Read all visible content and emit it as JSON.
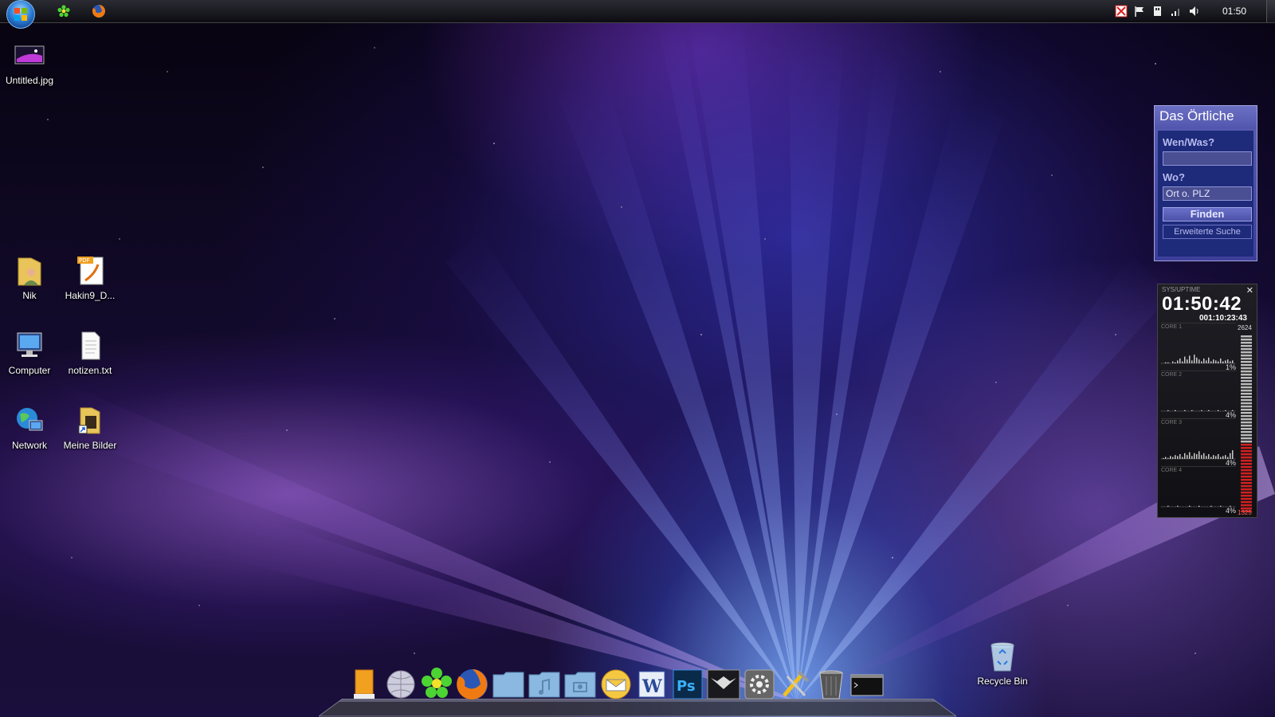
{
  "taskbar": {
    "clock": "01:50",
    "quick_launch": [
      "icq-icon",
      "firefox-icon"
    ],
    "tray_icons": [
      "security-alert-icon",
      "action-center-flag-icon",
      "usb-device-icon",
      "network-signal-icon",
      "volume-icon"
    ]
  },
  "desktop_icons": [
    {
      "name": "Untitled.jpg",
      "icon": "image-file-icon"
    },
    {
      "name": "Nik",
      "icon": "user-folder-icon"
    },
    {
      "name": "Hakin9_D...",
      "icon": "pdf-file-icon"
    },
    {
      "name": "Computer",
      "icon": "computer-icon"
    },
    {
      "name": "notizen.txt",
      "icon": "text-file-icon"
    },
    {
      "name": "Network",
      "icon": "network-icon"
    },
    {
      "name": "Meine Bilder",
      "icon": "pictures-shortcut-icon"
    }
  ],
  "recycle_bin": {
    "label": "Recycle Bin"
  },
  "gadget_oertliche": {
    "title": "Das Örtliche",
    "who_label": "Wen/Was?",
    "who_value": "",
    "where_label": "Wo?",
    "where_placeholder": "Ort o. PLZ",
    "find_button": "Finden",
    "advanced_link": "Erweiterte Suche"
  },
  "gadget_sys": {
    "header": "SYS/UPTIME",
    "time": "01:50:42",
    "uptime": "001:10:23:43",
    "meter_max": "2624",
    "meter_min": "1325",
    "cores": [
      {
        "label": "CORE 1",
        "pct": "1%",
        "samples": [
          0,
          1,
          1,
          0,
          2,
          1,
          3,
          5,
          2,
          7,
          4,
          8,
          3,
          9,
          6,
          4,
          2,
          5,
          3,
          6,
          2,
          4,
          3,
          2,
          5,
          2,
          3,
          4,
          2,
          3
        ]
      },
      {
        "label": "CORE 2",
        "pct": "4%",
        "samples": [
          0,
          0,
          1,
          0,
          0,
          1,
          0,
          0,
          0,
          1,
          0,
          0,
          1,
          0,
          0,
          0,
          1,
          0,
          0,
          1,
          0,
          0,
          0,
          1,
          0,
          0,
          1,
          0,
          0,
          1
        ]
      },
      {
        "label": "CORE 3",
        "pct": "4%",
        "samples": [
          1,
          2,
          1,
          3,
          2,
          4,
          3,
          5,
          2,
          6,
          4,
          7,
          3,
          6,
          5,
          8,
          4,
          6,
          3,
          5,
          2,
          4,
          3,
          5,
          2,
          3,
          4,
          2,
          6,
          9
        ]
      },
      {
        "label": "CORE 4",
        "pct": "4%",
        "samples": [
          0,
          0,
          1,
          0,
          0,
          0,
          1,
          0,
          0,
          0,
          0,
          1,
          0,
          0,
          0,
          1,
          0,
          0,
          0,
          0,
          1,
          0,
          0,
          0,
          1,
          0,
          0,
          0,
          1,
          0
        ]
      }
    ]
  },
  "dock_items": [
    "hard-drive-icon",
    "network-globe-icon",
    "icq-flower-icon",
    "firefox-icon",
    "folder-icon",
    "music-folder-icon",
    "pictures-folder-icon",
    "mail-icon",
    "word-icon",
    "photoshop-icon",
    "eagle-app-icon",
    "system-preferences-icon",
    "utilities-icon",
    "trash-icon",
    "terminal-icon"
  ],
  "colors": {
    "gadget_blue": "#3d3f99",
    "meter_red": "#d02020",
    "meter_gray": "#bbbbbb"
  }
}
